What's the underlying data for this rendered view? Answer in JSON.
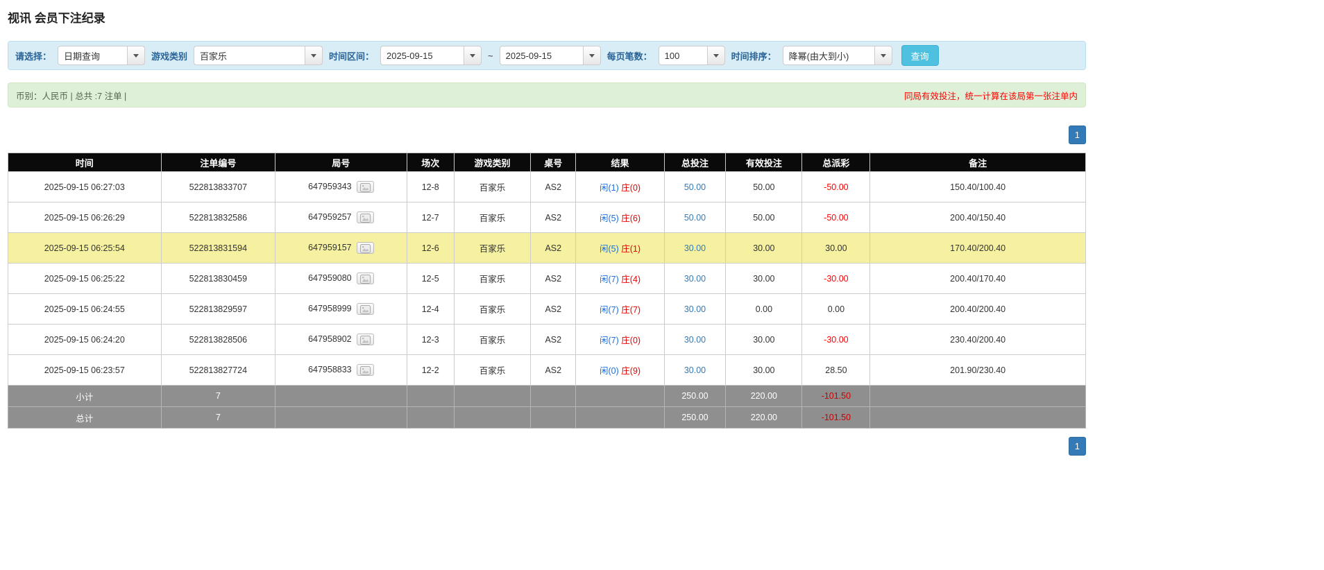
{
  "page": {
    "title": "视讯 会员下注纪录"
  },
  "filters": {
    "select_label": "请选择：",
    "select_value": "日期查询",
    "game_type_label": "游戏类别",
    "game_type_value": "百家乐",
    "time_range_label": "时间区间：",
    "time_from": "2025-09-15",
    "time_separator": "~",
    "time_to": "2025-09-15",
    "page_size_label": "每页笔数：",
    "page_size_value": "100",
    "sort_label": "时间排序：",
    "sort_value": "降幂(由大到小)",
    "search_button": "查询"
  },
  "info_bar": {
    "summary": "币别：人民币 | 总共 :7 注单 |",
    "notice": "同局有效投注，统一计算在该局第一张注单内"
  },
  "pagination": {
    "page": "1"
  },
  "table": {
    "headers": [
      "时间",
      "注单编号",
      "局号",
      "场次",
      "游戏类别",
      "桌号",
      "结果",
      "总投注",
      "有效投注",
      "总派彩",
      "备注"
    ],
    "rows": [
      {
        "time": "2025-09-15 06:27:03",
        "bet_id": "522813833707",
        "round_id": "647959343",
        "session": "12-8",
        "game_type": "百家乐",
        "table_no": "AS2",
        "result_player": "闲(1)",
        "result_banker": "庄(0)",
        "total_bet": "50.00",
        "valid_bet": "50.00",
        "payout": "-50.00",
        "note": "150.40/100.40",
        "highlight": false
      },
      {
        "time": "2025-09-15 06:26:29",
        "bet_id": "522813832586",
        "round_id": "647959257",
        "session": "12-7",
        "game_type": "百家乐",
        "table_no": "AS2",
        "result_player": "闲(5)",
        "result_banker": "庄(6)",
        "total_bet": "50.00",
        "valid_bet": "50.00",
        "payout": "-50.00",
        "note": "200.40/150.40",
        "highlight": false
      },
      {
        "time": "2025-09-15 06:25:54",
        "bet_id": "522813831594",
        "round_id": "647959157",
        "session": "12-6",
        "game_type": "百家乐",
        "table_no": "AS2",
        "result_player": "闲(5)",
        "result_banker": "庄(1)",
        "total_bet": "30.00",
        "valid_bet": "30.00",
        "payout": "30.00",
        "note": "170.40/200.40",
        "highlight": true
      },
      {
        "time": "2025-09-15 06:25:22",
        "bet_id": "522813830459",
        "round_id": "647959080",
        "session": "12-5",
        "game_type": "百家乐",
        "table_no": "AS2",
        "result_player": "闲(7)",
        "result_banker": "庄(4)",
        "total_bet": "30.00",
        "valid_bet": "30.00",
        "payout": "-30.00",
        "note": "200.40/170.40",
        "highlight": false
      },
      {
        "time": "2025-09-15 06:24:55",
        "bet_id": "522813829597",
        "round_id": "647958999",
        "session": "12-4",
        "game_type": "百家乐",
        "table_no": "AS2",
        "result_player": "闲(7)",
        "result_banker": "庄(7)",
        "total_bet": "30.00",
        "valid_bet": "0.00",
        "payout": "0.00",
        "note": "200.40/200.40",
        "highlight": false
      },
      {
        "time": "2025-09-15 06:24:20",
        "bet_id": "522813828506",
        "round_id": "647958902",
        "session": "12-3",
        "game_type": "百家乐",
        "table_no": "AS2",
        "result_player": "闲(7)",
        "result_banker": "庄(0)",
        "total_bet": "30.00",
        "valid_bet": "30.00",
        "payout": "-30.00",
        "note": "230.40/200.40",
        "highlight": false
      },
      {
        "time": "2025-09-15 06:23:57",
        "bet_id": "522813827724",
        "round_id": "647958833",
        "session": "12-2",
        "game_type": "百家乐",
        "table_no": "AS2",
        "result_player": "闲(0)",
        "result_banker": "庄(9)",
        "total_bet": "30.00",
        "valid_bet": "30.00",
        "payout": "28.50",
        "note": "201.90/230.40",
        "highlight": false
      }
    ],
    "subtotal": {
      "label": "小计",
      "count": "7",
      "total_bet": "250.00",
      "valid_bet": "220.00",
      "payout": "-101.50"
    },
    "total": {
      "label": "总计",
      "count": "7",
      "total_bet": "250.00",
      "valid_bet": "220.00",
      "payout": "-101.50"
    }
  }
}
